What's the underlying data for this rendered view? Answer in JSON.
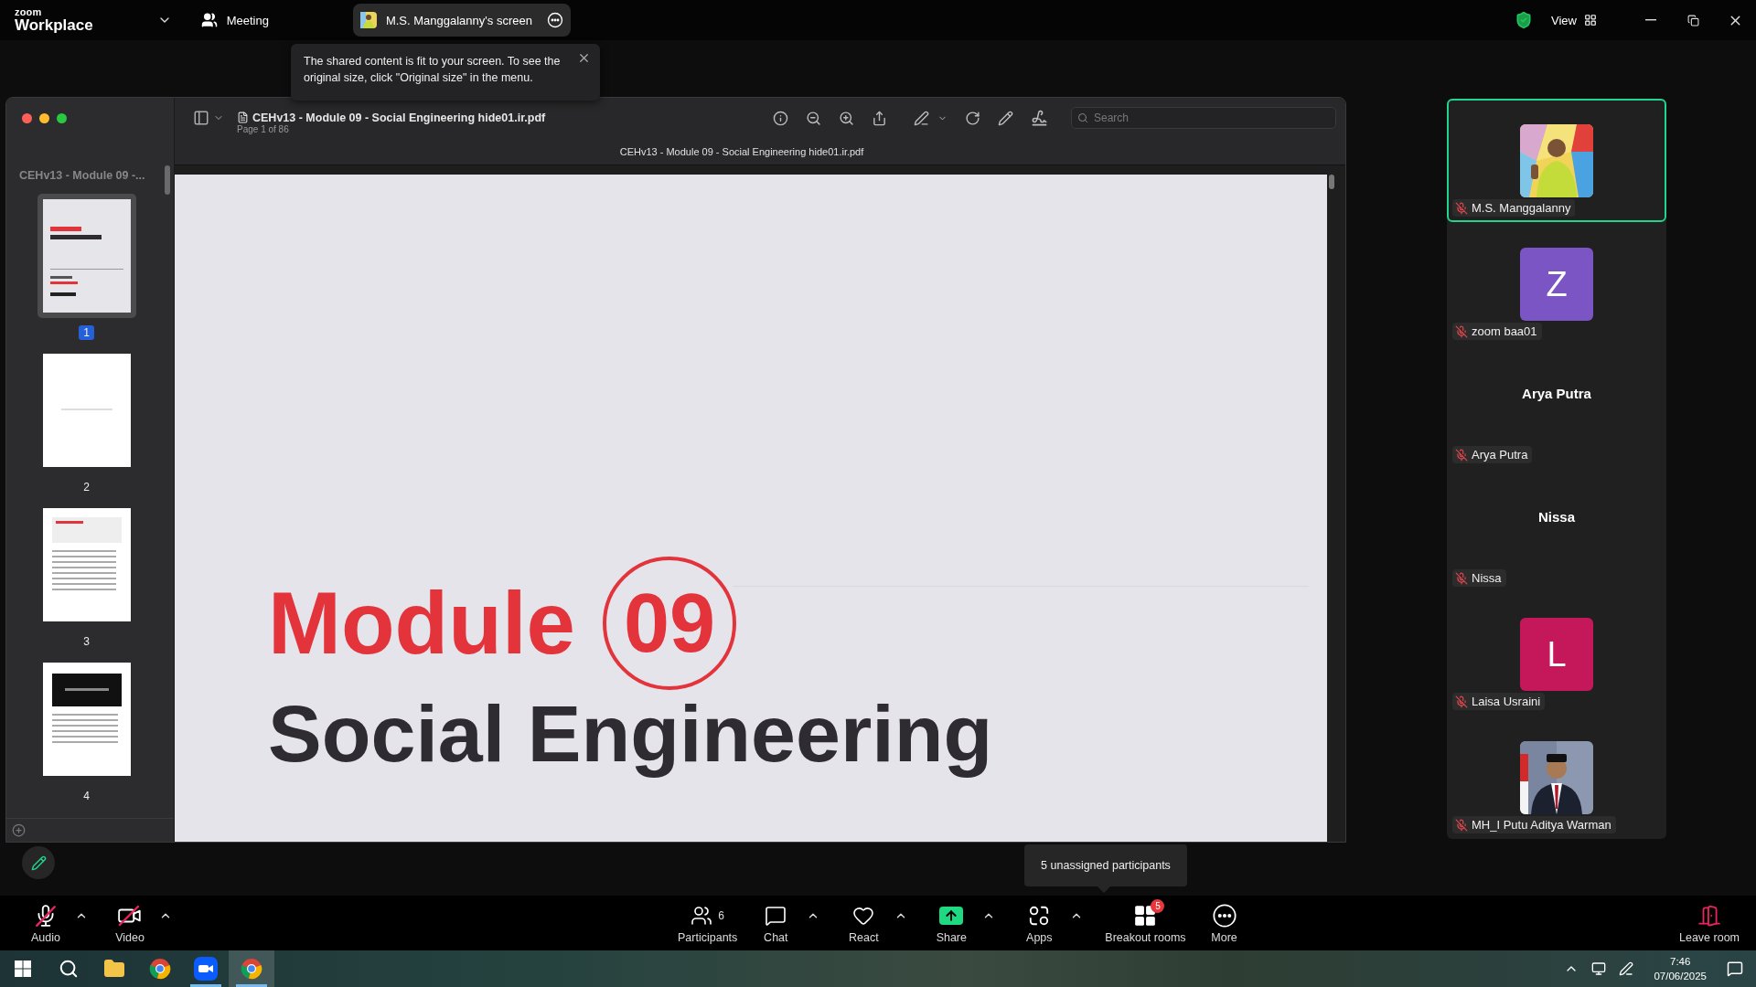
{
  "app": {
    "logo_top": "zoom",
    "logo_bottom": "Workplace",
    "menu_label": "Meeting"
  },
  "share_indicator": {
    "label": "M.S. Manggalanny's screen"
  },
  "view_button": {
    "label": "View"
  },
  "notice": {
    "text": "The shared content is fit to your screen. To see the original size, click \"Original size\" in the menu."
  },
  "pdf": {
    "sidebar_title": "CEHv13 - Module 09 -...",
    "thumbnails": [
      {
        "label": "1",
        "kind": "cover",
        "selected": true
      },
      {
        "label": "2",
        "kind": "blank",
        "selected": false
      },
      {
        "label": "3",
        "kind": "text",
        "selected": false
      },
      {
        "label": "4",
        "kind": "section",
        "selected": false
      }
    ],
    "title": "CEHv13 - Module 09 - Social Engineering hide01.ir.pdf",
    "page_info": "Page 1 of 86",
    "search": {
      "placeholder": "Search"
    },
    "tab_title": "CEHv13 - Module 09 - Social Engineering hide01.ir.pdf",
    "page": {
      "module_word": "Module",
      "module_number": "09",
      "heading": "Social Engineering"
    }
  },
  "participants": [
    {
      "name": "M.S. Manggalanny",
      "active": true,
      "muted": true
    },
    {
      "name": "zoom baa01",
      "kind": "initial",
      "initial": "Z",
      "color": "#7c55c4",
      "active": false,
      "muted": true
    },
    {
      "name": "Arya Putra",
      "kind": "name",
      "display": "Arya Putra",
      "active": false,
      "muted": true
    },
    {
      "name": "Nissa",
      "kind": "name",
      "display": "Nissa",
      "active": false,
      "muted": true
    },
    {
      "name": "Laisa Usraini",
      "kind": "initial",
      "initial": "L",
      "color": "#c4185a",
      "active": false,
      "muted": true
    },
    {
      "name": "MH_I Putu Aditya Warman",
      "active": false,
      "muted": true
    }
  ],
  "hint": "5 unassigned participants",
  "toolbar": [
    {
      "kind": "audio",
      "label": "Audio",
      "off": true,
      "menu": true
    },
    {
      "kind": "video",
      "label": "Video",
      "off": true,
      "menu": true
    },
    {
      "kind": "participants",
      "label": "Participants",
      "count": "6",
      "menu": false
    },
    {
      "kind": "chat",
      "label": "Chat",
      "menu": true
    },
    {
      "kind": "react",
      "label": "React",
      "menu": true
    },
    {
      "kind": "share",
      "label": "Share",
      "menu": true
    },
    {
      "kind": "apps",
      "label": "Apps",
      "menu": true
    },
    {
      "kind": "breakout",
      "label": "Breakout rooms",
      "badge": "5",
      "menu": false
    },
    {
      "kind": "more",
      "label": "More",
      "menu": false
    },
    {
      "kind": "leave",
      "label": "Leave room",
      "menu": false
    }
  ],
  "taskbar": {
    "apps": [
      {
        "kind": "start",
        "running": false,
        "selected": false
      },
      {
        "kind": "search",
        "running": false,
        "selected": false
      },
      {
        "kind": "files",
        "running": false,
        "selected": false
      },
      {
        "kind": "browser",
        "running": false,
        "selected": false
      },
      {
        "kind": "meeting",
        "running": true,
        "selected": false
      },
      {
        "kind": "browser",
        "running": true,
        "selected": true
      }
    ],
    "time": "7:46",
    "date": "07/06/2025"
  }
}
